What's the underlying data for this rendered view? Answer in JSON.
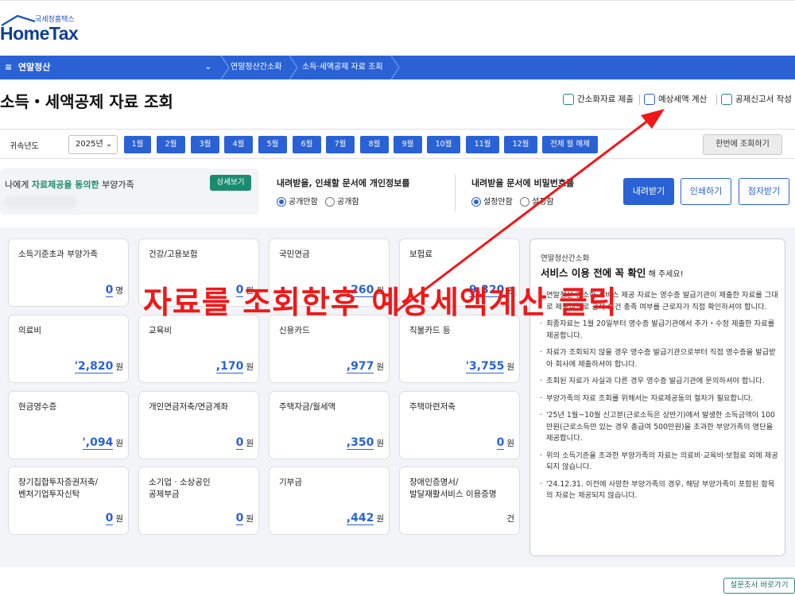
{
  "header": {
    "logo_sub": "국세청홈택스",
    "logo_main": "HomeTax"
  },
  "nav": {
    "menu_label": "연말정산",
    "breadcrumbs": [
      "연말정산간소화",
      "소득·세액공제 자료 조회"
    ]
  },
  "page": {
    "title": "소득・세액공제 자료 조회"
  },
  "actions": [
    {
      "label": "간소화자료 제출",
      "icon": "document-check-icon"
    },
    {
      "label": "예상세액 계산",
      "icon": "calculator-icon"
    },
    {
      "label": "공제신고서 작성",
      "icon": "pencil-document-icon"
    }
  ],
  "year_filter": {
    "label": "귀속년도",
    "selected_year": "2025년",
    "months": [
      "1월",
      "2월",
      "3월",
      "4월",
      "5월",
      "6월",
      "7월",
      "8월",
      "9월",
      "10월",
      "11월",
      "12월",
      "전체 월 해제"
    ],
    "lookup_button": "한번에 조회하기"
  },
  "consent": {
    "prefix": "나에게 ",
    "highlight": "자료제공을 동의한",
    "suffix": " 부양가족",
    "detail_button": "상세보기"
  },
  "privacy_option": {
    "title": "내려받을, 인쇄할 문서에 개인정보를",
    "options": [
      "공개안함",
      "공개함"
    ]
  },
  "password_option": {
    "title": "내려받을 문서에 비밀번호를",
    "options": [
      "설정안함",
      "설정함"
    ]
  },
  "buttons": {
    "download": "내려받기",
    "print": "인쇄하기",
    "braille": "점자받기"
  },
  "cards": [
    {
      "title": "소득기준초과 부양가족",
      "value": "0",
      "unit": "명"
    },
    {
      "title": "건강/고용보험",
      "value": "0",
      "unit": "원"
    },
    {
      "title": "국민연금",
      "value": ",260",
      "unit": "원"
    },
    {
      "title": "보험료",
      "value": "9,320",
      "unit": "원"
    },
    {
      "title": "의료비",
      "value": "'2,820",
      "unit": "원"
    },
    {
      "title": "교육비",
      "value": ",170",
      "unit": "원"
    },
    {
      "title": "신용카드",
      "value": ",977",
      "unit": "원"
    },
    {
      "title": "직불카드 등",
      "value": "'3,755",
      "unit": "원"
    },
    {
      "title": "현금영수증",
      "value": "',094",
      "unit": "원"
    },
    {
      "title": "개인연금저축/연금계좌",
      "value": "0",
      "unit": "원"
    },
    {
      "title": "주택자금/월세액",
      "value": ",350",
      "unit": "원"
    },
    {
      "title": "주택마련저축",
      "value": "0",
      "unit": "원"
    },
    {
      "title": "장기집합투자증권저축/\n벤처기업투자신탁",
      "value": "0",
      "unit": "원"
    },
    {
      "title": "소기업 · 소상공인\n공제부금",
      "value": "0",
      "unit": "원"
    },
    {
      "title": "기부금",
      "value": ",442",
      "unit": "원"
    },
    {
      "title": "장애인증명서/\n발달재활서비스 이용증명",
      "value": "",
      "unit": "건"
    }
  ],
  "notice": {
    "subtitle": "연말정산간소화",
    "headline": "서비스 이용 전에 꼭 확인",
    "headline_suffix": " 해 주세요!",
    "items": [
      "연말정산 간소화 서비스 제공 자료는 영수증 발급기관이 제출한 자료를 그대로 제공하므로 공제 요건 충족 여부를 근로자가 직접 확인하셔야 합니다.",
      "최종자료는 1월 20일부터 영수증 발급기관에서 추가・수정 제출한 자료를 제공합니다.",
      "자료가 조회되지 않을 경우 영수증 발급기관으로부터 직접 영수증을 발급받아 회사에 제출하셔야 합니다.",
      "조회된 자료가 사실과 다른 경우 영수증 발급기관에 문의하셔야 합니다.",
      "부양가족의 자료 조회를 위해서는 자료제공동의 절차가 필요합니다.",
      "'25년 1월~10월 신고분(근로소득은 상반기)에서 발생한 소득금액이 100만원(근로소득만 있는 경우 총급여 500만원)을 초과한 부양가족의 명단을 제공합니다.",
      "위의 소득기준을 초과한 부양가족의 자료는 의료비·교육비·보험료 외에 제공되지 않습니다.",
      "'24.12.31. 이전에 사망한 부양가족의 경우, 해당 부양가족이 포함된 항목의 자료는 제공되지 않습니다."
    ]
  },
  "survey_button": "설문조사 바로가기",
  "annotation": {
    "text": "자료를 조회한후 예상세액계산 클릭",
    "color": "#f01818"
  }
}
